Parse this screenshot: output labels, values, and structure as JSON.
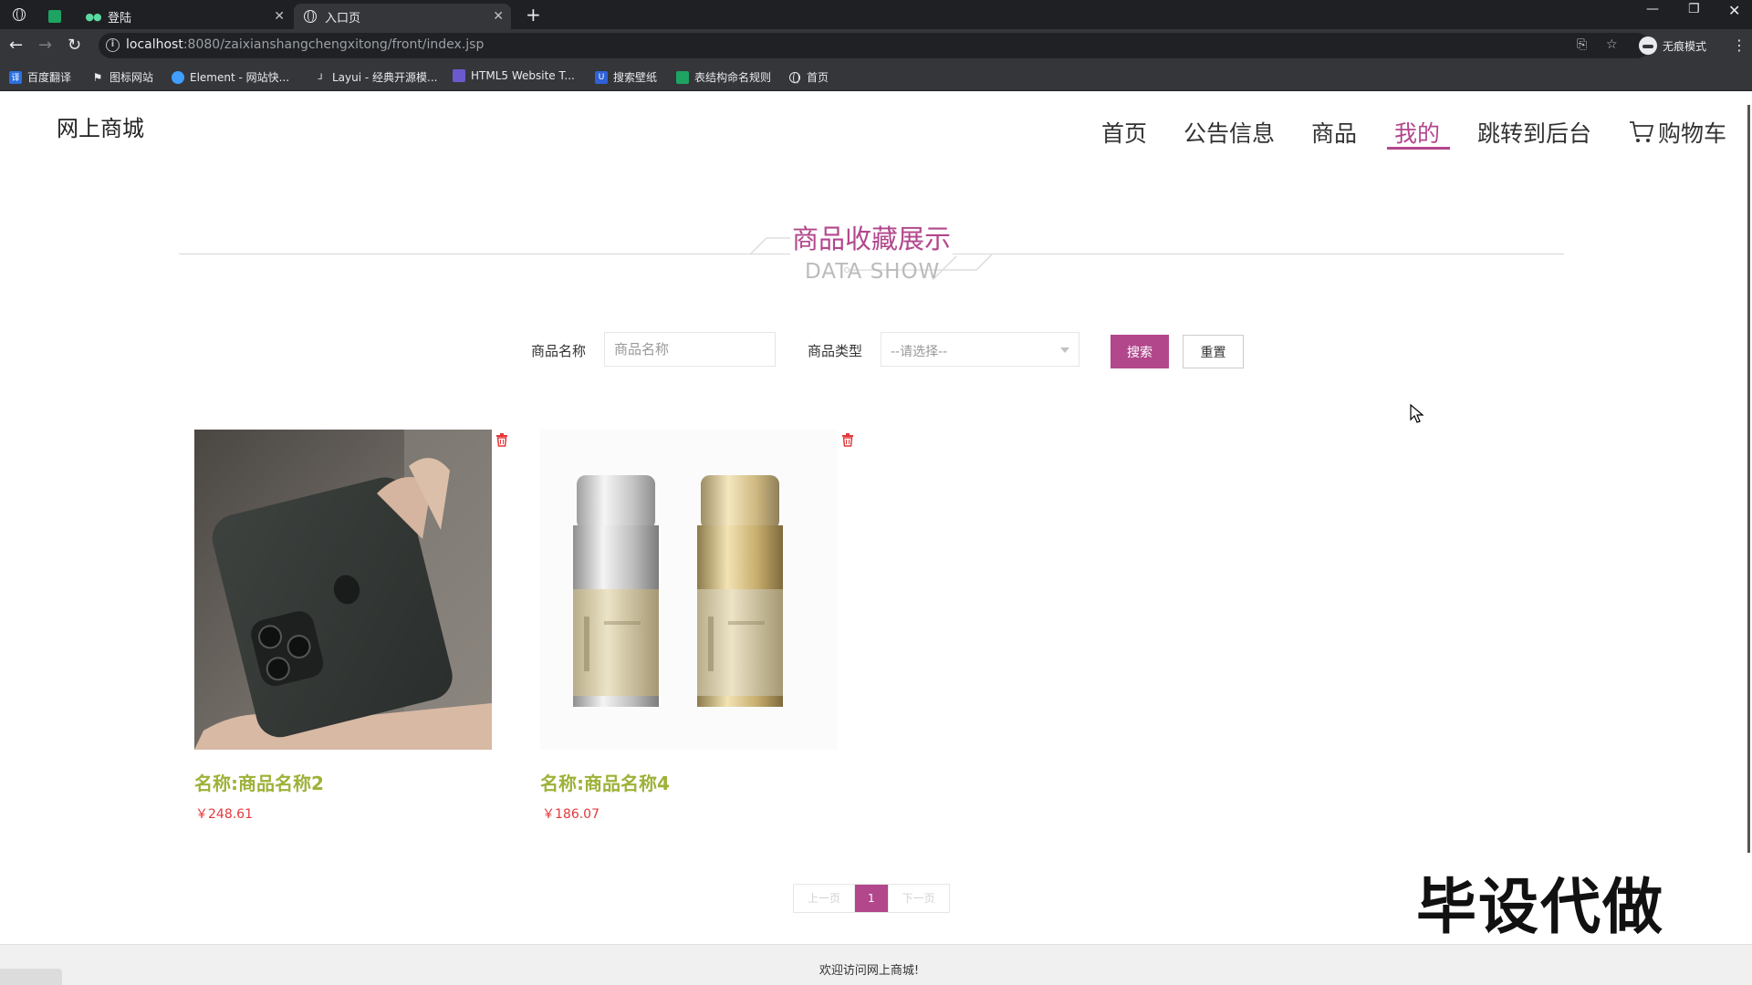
{
  "browser": {
    "tabs": [
      {
        "label": "",
        "icon": "green-sheet-icon"
      },
      {
        "label": "登陆",
        "icon": "dots-icon"
      },
      {
        "label": "入口页",
        "icon": "globe-icon"
      }
    ],
    "url_host": "localhost",
    "url_path": ":8080/zaixianshangchengxitong/front/index.jsp",
    "incognito_label": "无痕模式",
    "bookmarks": [
      "百度翻译",
      "图标网站",
      "Element - 网站快...",
      "Layui - 经典开源模...",
      "HTML5 Website T...",
      "搜索壁纸",
      "表结构命名规则",
      "首页"
    ]
  },
  "header": {
    "logo": "网上商城",
    "nav": [
      "首页",
      "公告信息",
      "商品",
      "我的",
      "跳转到后台",
      "购物车"
    ],
    "active_nav": "我的"
  },
  "section": {
    "title_cn": "商品收藏展示",
    "title_en": "DATA SHOW"
  },
  "search": {
    "name_label": "商品名称",
    "name_placeholder": "商品名称",
    "type_label": "商品类型",
    "type_value": "--请选择--",
    "search_button": "搜索",
    "reset_button": "重置"
  },
  "products": [
    {
      "name": "名称:商品名称2",
      "price": "￥248.61",
      "image": "phone-photo"
    },
    {
      "name": "名称:商品名称4",
      "price": "￥186.07",
      "image": "cosmetic-bottles-photo"
    }
  ],
  "pagination": {
    "prev": "上一页",
    "current": "1",
    "next": "下一页"
  },
  "watermark": "毕设代做",
  "footer": "欢迎访问网上商城!",
  "colors": {
    "accent": "#b2478c",
    "product_name": "#9eb138",
    "price": "#e4393c"
  }
}
